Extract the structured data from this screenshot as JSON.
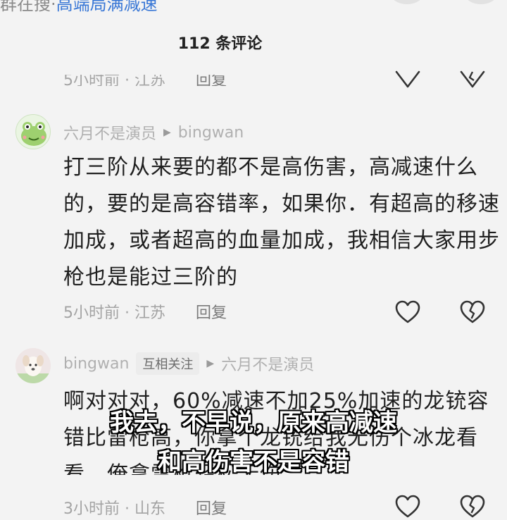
{
  "header": {
    "crumb_prefix": "群在搜·",
    "crumb_link": "高端局满减速",
    "comment_count": "112 条评论"
  },
  "comments": [
    {
      "time_location": "5小时前 · 江苏",
      "reply_label": "回复"
    },
    {
      "user": "六月不是演员",
      "reply_to": "bingwan",
      "text": "打三阶从来要的都不是高伤害，高减速什么的，要的是高容错率，如果你．有超高的移速加成，或者超高的血量加成，我相信大家用步枪也是能过三阶的",
      "time_location": "5小时前 · 江苏",
      "reply_label": "回复",
      "avatar_icon": "frog-avatar"
    },
    {
      "user": "bingwan",
      "badge": "互相关注",
      "reply_to": "六月不是演员",
      "text": "啊对对对，60%减速不加25%加速的龙铳容错比雷枪高，你拿个龙铳给我无伤个冰龙看看，俺拿雷枪轻松无伤",
      "time_location": "3小时前 · 山东",
      "reply_label": "回复",
      "avatar_icon": "puppy-avatar"
    }
  ],
  "subtitle": {
    "line1": "我去，不早说，原来高减速",
    "line2": "和高伤害不是容错"
  },
  "icons": {
    "like": "heart-outline-icon",
    "dislike": "broken-heart-outline-icon",
    "arrow": "play-arrow-icon"
  },
  "colors": {
    "background": "#f3f3f3",
    "link": "#3a78d6",
    "meta_text": "#a3a3a3"
  }
}
